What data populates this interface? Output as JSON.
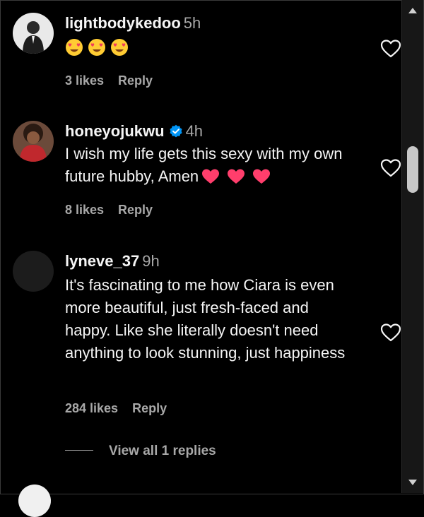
{
  "comments": [
    {
      "username": "lightbodykedoo",
      "time": "5h",
      "likes": "3 likes",
      "reply": "Reply",
      "emojis": [
        "smiling-face-with-heart-eyes",
        "smiling-face-with-heart-eyes",
        "smiling-face-with-heart-eyes"
      ]
    },
    {
      "username": "honeyojukwu",
      "verified": true,
      "time": "4h",
      "text": "I wish my life gets this sexy with my own future hubby, Amen",
      "likes": "8 likes",
      "reply": "Reply"
    },
    {
      "username": "lyneve_37",
      "time": "9h",
      "text": "It's fascinating to me how Ciara is even more beautiful, just fresh-faced and happy. Like she literally doesn't need anything to look stunning, just happiness",
      "likes": "284 likes",
      "reply": "Reply"
    }
  ],
  "view_replies": "View all 1 replies",
  "colors": {
    "background": "#000000",
    "text": "#f5f5f5",
    "secondary_text": "#a8a8a8",
    "verified": "#0095f6",
    "heart_emoji": "#ff3e6c"
  }
}
